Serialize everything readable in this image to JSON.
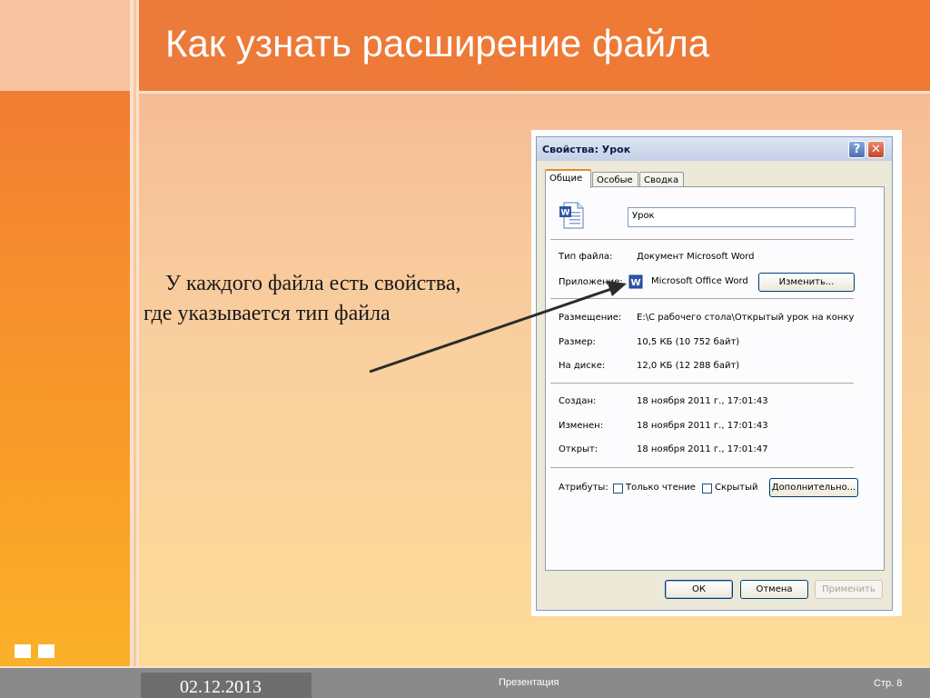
{
  "slide": {
    "title": "Как узнать расширение файла",
    "body_text": "У каждого файла есть свойства, где указывается тип файла"
  },
  "footer": {
    "date": "02.12.2013",
    "center": "Презентация",
    "page": "Стр. 8"
  },
  "dialog": {
    "title": "Свойства: Урок",
    "help_glyph": "?",
    "close_glyph": "✕",
    "tabs": [
      "Общие",
      "Особые",
      "Сводка"
    ],
    "file_name": "Урок",
    "rows": {
      "type_label": "Тип файла:",
      "type_value": "Документ Microsoft Word",
      "app_label": "Приложение:",
      "app_value": "Microsoft Office Word",
      "change_button": "Изменить...",
      "location_label": "Размещение:",
      "location_value": "E:\\С рабочего стола\\Открытый урок на конку",
      "size_label": "Размер:",
      "size_value": "10,5 КБ (10 752 байт)",
      "disk_label": "На диске:",
      "disk_value": "12,0 КБ (12 288 байт)",
      "created_label": "Создан:",
      "created_value": "18 ноября 2011 г., 17:01:43",
      "modified_label": "Изменен:",
      "modified_value": "18 ноября 2011 г., 17:01:43",
      "opened_label": "Открыт:",
      "opened_value": "18 ноября 2011 г., 17:01:47",
      "attrs_label": "Атрибуты:",
      "readonly_label": "Только чтение",
      "hidden_label": "Скрытый",
      "advanced_button": "Дополнительно..."
    },
    "buttons": {
      "ok": "ОК",
      "cancel": "Отмена",
      "apply": "Применить"
    }
  },
  "colors": {
    "title_band": "#f07a33",
    "accent_orange": "#f58a2e",
    "footer": "#8a8a8a"
  }
}
